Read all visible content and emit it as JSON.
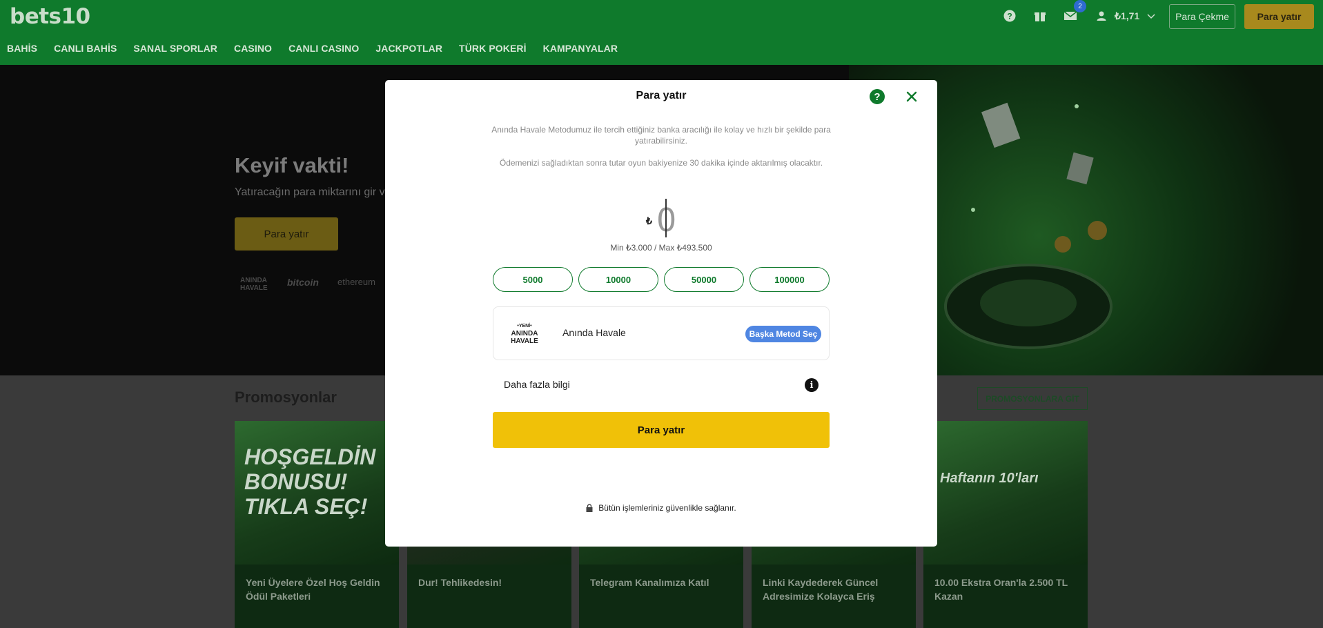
{
  "header": {
    "logo": "bets10",
    "nav": [
      "BAHİS",
      "CANLI BAHİS",
      "SANAL SPORLAR",
      "CASINO",
      "CANLI CASINO",
      "JACKPOTLAR",
      "TÜRK POKERİ",
      "KAMPANYALAR"
    ],
    "message_count": "2",
    "balance": "₺1,71",
    "withdraw_label": "Para Çekme",
    "deposit_label": "Para yatır"
  },
  "hero": {
    "title": "Keyif vakti!",
    "subtitle": "Yatıracağın para miktarını gir ve",
    "button_label": "Para yatır",
    "payment_logos": [
      "ANINDA HAVALE",
      "bitcoin",
      "ethereum"
    ]
  },
  "promotions": {
    "title": "Promosyonlar",
    "go_label": "PROMOSYONLARA GİT",
    "cards": [
      {
        "text": "Yeni Üyelere Özel Hoş Geldin Ödül Paketleri",
        "image_text": "HOŞGELDİN BONUSU! TIKLA SEÇ!"
      },
      {
        "text": "Dur! Tehlikedesin!"
      },
      {
        "text": "Telegram Kanalımıza Katıl"
      },
      {
        "text": "Linki Kaydederek Güncel Adresimize Kolayca Eriş"
      },
      {
        "text": "10.00 Ekstra Oran'la 2.500 TL Kazan",
        "image_text": "Haftanın 10'ları"
      }
    ]
  },
  "modal": {
    "title": "Para yatır",
    "description_1": "Anında Havale Metodumuz ile tercih ettiğiniz banka aracılığı ile kolay ve hızlı bir şekilde para yatırabilirsiniz.",
    "description_2": "Ödemenizi sağladıktan sonra tutar oyun bakiyenize 30 dakika içinde aktarılmış olacaktır.",
    "currency_symbol": "₺",
    "amount": "0",
    "minmax": "Min ₺3.000 / Max ₺493.500",
    "quick_amounts": [
      "5000",
      "10000",
      "50000",
      "100000"
    ],
    "method_logo": [
      "•YENİ•",
      "ANINDA",
      "HAVALE"
    ],
    "method_name": "Anında Havale",
    "change_method_label": "Başka Metod Seç",
    "more_info_label": "Daha fazla bilgi",
    "submit_label": "Para yatır",
    "secure_text": "Bütün işlemleriniz güvenlikle sağlanır."
  },
  "colors": {
    "brand_green": "#0f7a2c",
    "submit_yellow": "#f0c108",
    "method_blue": "#4f86e2"
  }
}
